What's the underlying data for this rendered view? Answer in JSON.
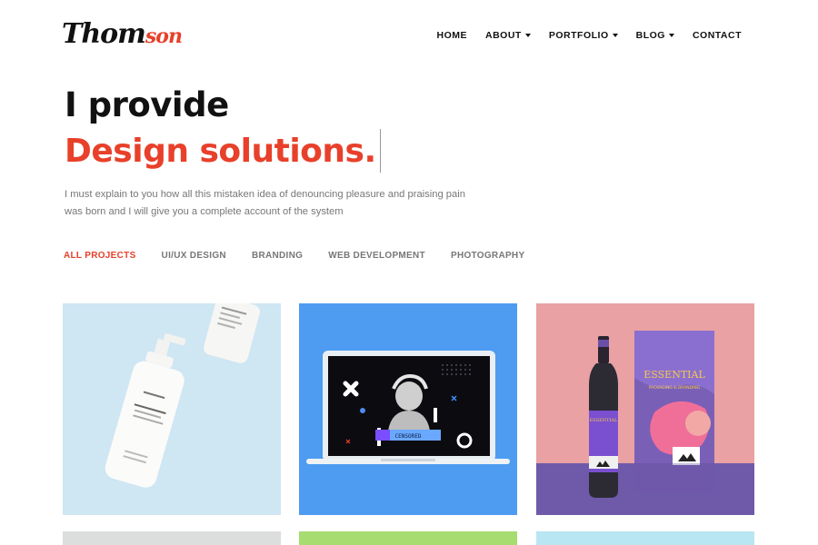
{
  "brand": {
    "logo_part1": "Thom",
    "logo_part2": "son"
  },
  "nav": {
    "items": [
      {
        "label": "HOME",
        "dropdown": false
      },
      {
        "label": "ABOUT",
        "dropdown": true
      },
      {
        "label": "PORTFOLIO",
        "dropdown": true
      },
      {
        "label": "BLOG",
        "dropdown": true
      },
      {
        "label": "CONTACT",
        "dropdown": false
      }
    ]
  },
  "hero": {
    "line1": "I provide",
    "line2": "Design solutions.",
    "description": "I must explain to you how all this mistaken idea of denouncing pleasure and praising pain was born and I will give you a complete account of the system"
  },
  "filters": {
    "active_index": 0,
    "items": [
      "ALL PROJECTS",
      "UI/UX DESIGN",
      "BRANDING",
      "WEB DEVELOPMENT",
      "PHOTOGRAPHY"
    ]
  },
  "portfolio": {
    "card2": {
      "screen_label": "CENSORED"
    },
    "card3": {
      "box_title": "ESSENTIAL",
      "box_subtitle": "PACKAGING & BRANDING",
      "bottle_label": "ESSENTIAL"
    }
  },
  "colors": {
    "accent": "#e8402a",
    "text": "#111111",
    "muted": "#777777"
  }
}
